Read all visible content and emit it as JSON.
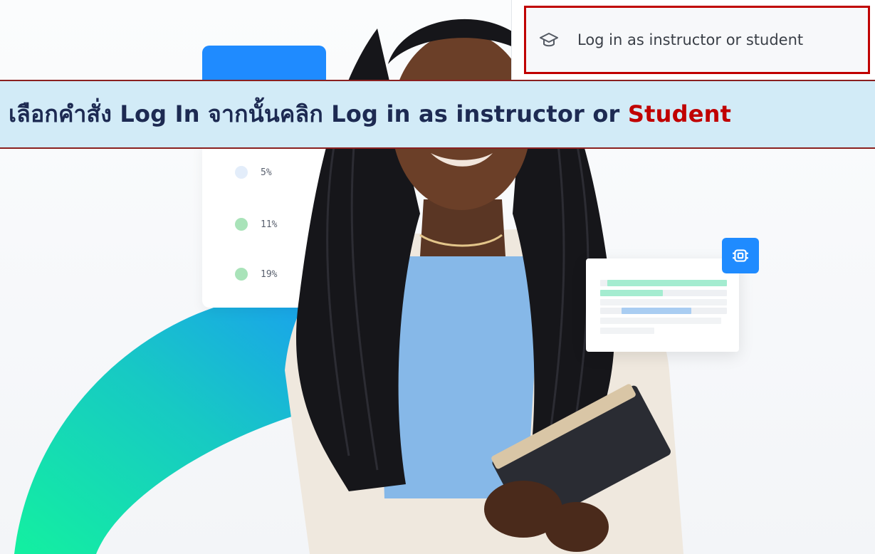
{
  "dropdown": {
    "login_item": {
      "label": "Log in as instructor or student",
      "icon": "graduation-cap-icon"
    }
  },
  "banner": {
    "instruction_main": "เลือกคำสั่ง Log In จากนั้นคลิก Log in as instructor or ",
    "instruction_accent": "Student",
    "accent_color": "#c00000",
    "background_color": "#d2ebf7"
  },
  "stats_card": {
    "rows": [
      {
        "value": "5%",
        "color": "#e3edfa"
      },
      {
        "value": "11%",
        "color": "#a9e3b9"
      },
      {
        "value": "19%",
        "color": "#a9e3b9"
      }
    ],
    "header_color": "#1f8bff"
  },
  "gantt_widget": {
    "icon": "chip-icon",
    "accent_color": "#1f8bff"
  },
  "colors": {
    "arc_start": "#13e8a5",
    "arc_end": "#18a6ea",
    "highlight_border": "#c00000"
  }
}
